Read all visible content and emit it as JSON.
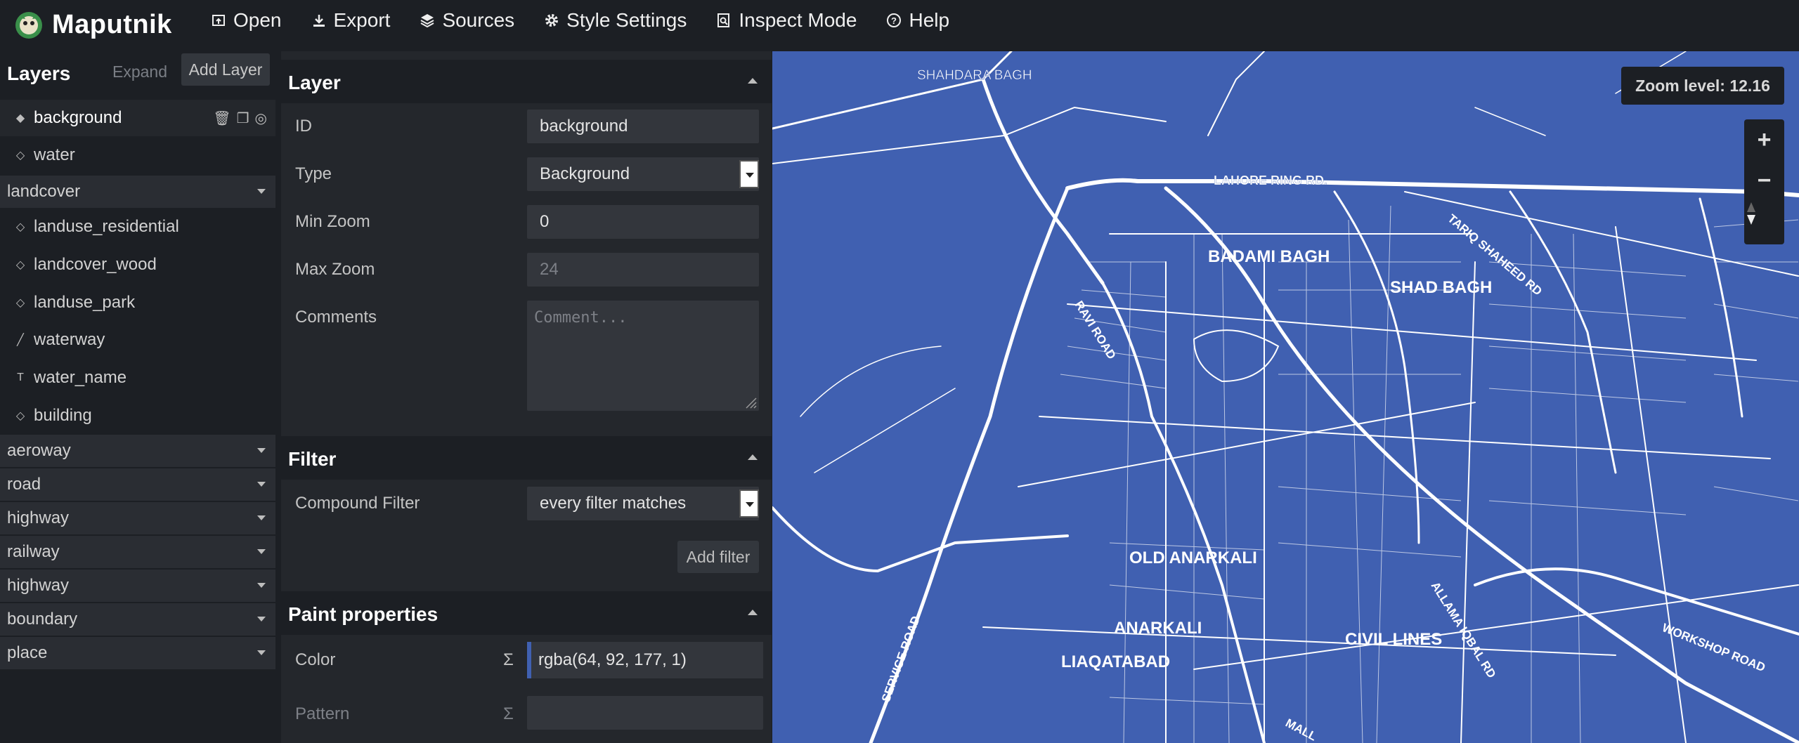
{
  "app": {
    "name": "Maputnik"
  },
  "nav": [
    {
      "label": "Open",
      "icon": "open-icon"
    },
    {
      "label": "Export",
      "icon": "download-icon"
    },
    {
      "label": "Sources",
      "icon": "layers-icon"
    },
    {
      "label": "Style Settings",
      "icon": "gear-icon"
    },
    {
      "label": "Inspect Mode",
      "icon": "inspect-icon"
    },
    {
      "label": "Help",
      "icon": "help-icon"
    }
  ],
  "layers": {
    "title": "Layers",
    "expand_label": "Expand",
    "add_label": "Add Layer",
    "items": [
      {
        "label": "background",
        "icon": "fill-icon"
      },
      {
        "label": "water",
        "icon": "fill-icon"
      },
      {
        "label": "landuse_residential",
        "icon": "fill-icon"
      },
      {
        "label": "landcover_wood",
        "icon": "fill-icon"
      },
      {
        "label": "landuse_park",
        "icon": "fill-icon"
      },
      {
        "label": "waterway",
        "icon": "line-icon"
      },
      {
        "label": "water_name",
        "icon": "symbol-icon"
      },
      {
        "label": "building",
        "icon": "fill-icon"
      }
    ],
    "groups": [
      "landcover",
      "aeroway",
      "road",
      "highway",
      "railway",
      "highway",
      "boundary",
      "place"
    ]
  },
  "editor": {
    "layer_section": "Layer",
    "id_label": "ID",
    "id_value": "background",
    "type_label": "Type",
    "type_value": "Background",
    "minzoom_label": "Min Zoom",
    "minzoom_value": "0",
    "maxzoom_label": "Max Zoom",
    "maxzoom_placeholder": "24",
    "comments_label": "Comments",
    "comments_placeholder": "Comment...",
    "filter_section": "Filter",
    "compound_label": "Compound Filter",
    "compound_value": "every filter matches",
    "add_filter_label": "Add filter",
    "paint_section": "Paint properties",
    "color_label": "Color",
    "color_value": "rgba(64, 92, 177, 1)",
    "pattern_label": "Pattern",
    "sigma": "Σ"
  },
  "map": {
    "zoom_text": "Zoom level: 12.16",
    "zoom_in": "+",
    "zoom_out": "−",
    "background_color": "#4060b1",
    "labels": {
      "shahdara": "SHAHDARA BAGH",
      "ring": "LAHORE RING RD.",
      "badami": "BADAMI BAGH",
      "shad": "SHAD BAGH",
      "tariq": "TARIQ SHAHEED RD",
      "ravi": "RAVI ROAD",
      "old_anarkali": "OLD ANARKALI",
      "anarkali": "ANARKALI",
      "civil": "CIVIL LINES",
      "liaqatabad": "LIAQATABAD",
      "allama": "ALLAMA IQBAL RD",
      "workshop": "WORKSHOP ROAD",
      "service": "SERVICE ROAD",
      "mall": "MALL"
    }
  }
}
